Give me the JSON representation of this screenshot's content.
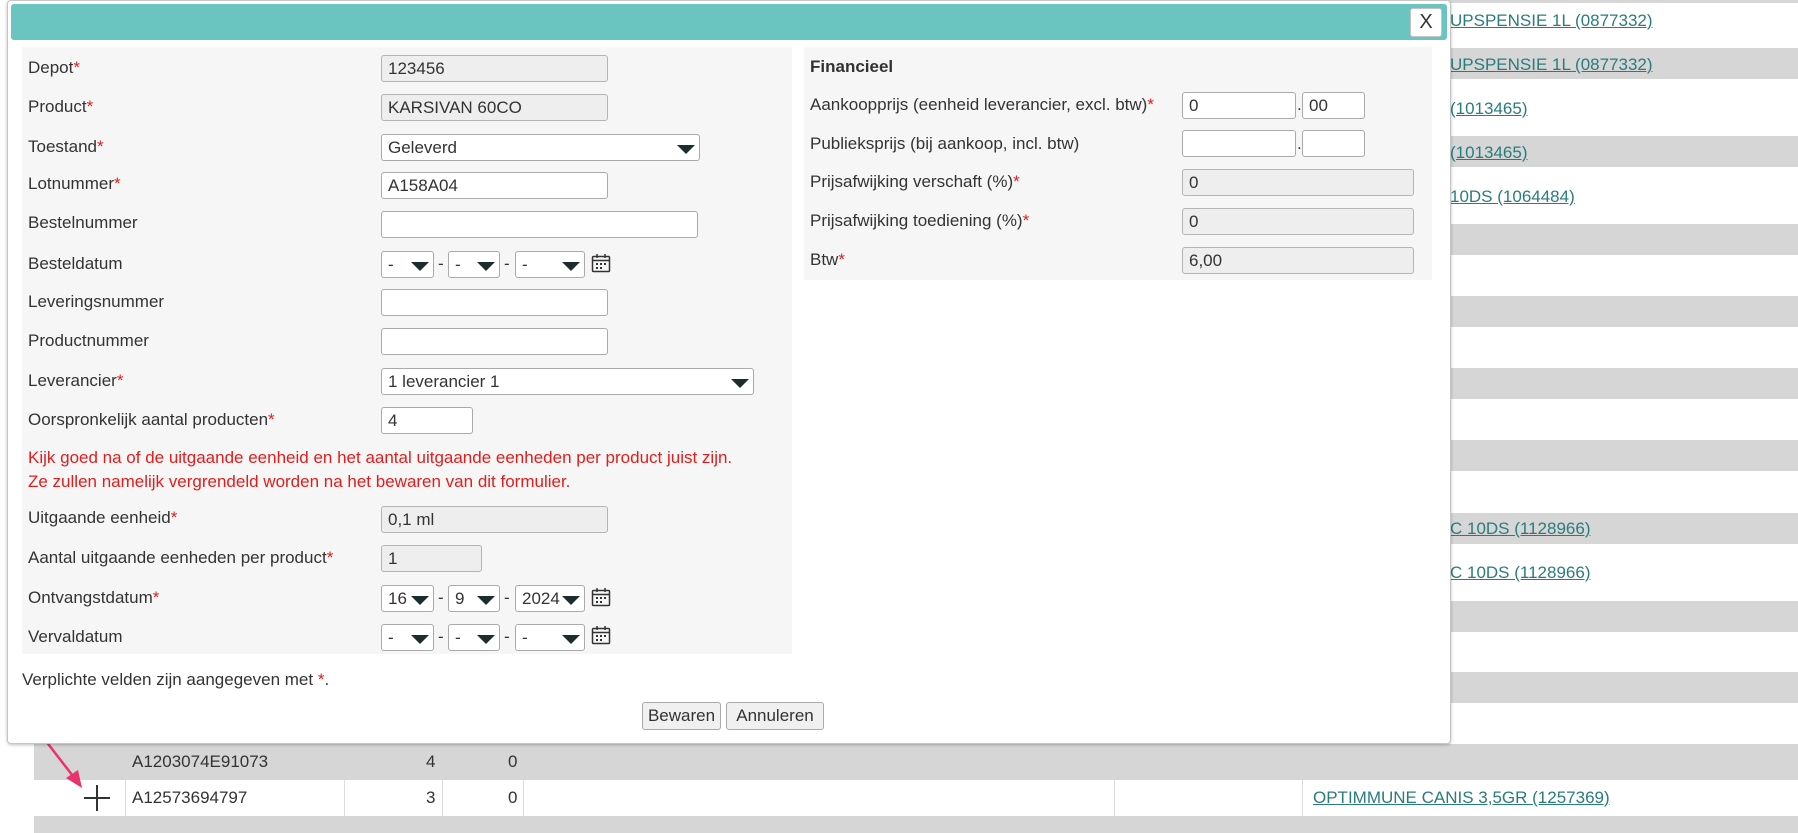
{
  "background": {
    "links": [
      "UPSPENSIE 1L (0877332)",
      "UPSPENSIE 1L (0877332)",
      "(1013465)",
      "(1013465)",
      "10DS (1064484)",
      "C 10DS (1128966)",
      "C 10DS (1128966)"
    ],
    "rows": [
      {
        "lot": "A1203074E91073",
        "qty": "4",
        "count": "0",
        "product": ""
      },
      {
        "lot": "A12573694797",
        "qty": "3",
        "count": "0",
        "product": "OPTIMMUNE CANIS 3,5GR (1257369)"
      }
    ],
    "arrow_color": "#e8336b"
  },
  "modal": {
    "close_label": "X",
    "header_color": "#6ac4c0",
    "fields": {
      "depot": {
        "label": "Depot",
        "value": "123456"
      },
      "product": {
        "label": "Product",
        "value": "KARSIVAN 60CO"
      },
      "toestand": {
        "label": "Toestand",
        "value": "Geleverd"
      },
      "lotnummer": {
        "label": "Lotnummer",
        "value": "A158A04"
      },
      "bestelnummer": {
        "label": "Bestelnummer",
        "value": ""
      },
      "besteldatum": {
        "label": "Besteldatum",
        "day": "-",
        "month": "-",
        "year": "-"
      },
      "leveringsnummer": {
        "label": "Leveringsnummer",
        "value": ""
      },
      "productnummer": {
        "label": "Productnummer",
        "value": ""
      },
      "leverancier": {
        "label": "Leverancier",
        "value": "1 leverancier 1"
      },
      "oorspronkelijk": {
        "label": "Oorspronkelijk aantal producten",
        "value": "4"
      },
      "uitgaande_eenheid": {
        "label": "Uitgaande eenheid",
        "value": "0,1 ml"
      },
      "aantal_uitgaande": {
        "label": "Aantal uitgaande eenheden per product",
        "value": "1"
      },
      "ontvangstdatum": {
        "label": "Ontvangstdatum",
        "day": "16",
        "month": "9",
        "year": "2024"
      },
      "vervaldatum": {
        "label": "Vervaldatum",
        "day": "-",
        "month": "-",
        "year": "-"
      }
    },
    "warning_line1": "Kijk goed na of de uitgaande eenheid en het aantal uitgaande eenheden per product juist zijn.",
    "warning_line2": "Ze zullen namelijk vergrendeld worden na het bewaren van dit formulier.",
    "date_separator": "-",
    "required_marker": "*",
    "financial": {
      "title": "Financieel",
      "aankoopprijs": {
        "label": "Aankoopprijs (eenheid leverancier, excl. btw)",
        "whole": "0",
        "decimal": "00"
      },
      "publieksprijs": {
        "label": "Publieksprijs (bij aankoop, incl. btw)",
        "whole": "",
        "decimal": ""
      },
      "prijsafwijking_verschaft": {
        "label": "Prijsafwijking verschaft (%)",
        "value": "0"
      },
      "prijsafwijking_toediening": {
        "label": "Prijsafwijking toediening (%)",
        "value": "0"
      },
      "btw": {
        "label": "Btw",
        "value": "6,00"
      },
      "decimal_separator": "."
    },
    "footer_note_prefix": "Verplichte velden zijn aangegeven met ",
    "footer_note_suffix": ".",
    "save_label": "Bewaren",
    "cancel_label": "Annuleren"
  }
}
